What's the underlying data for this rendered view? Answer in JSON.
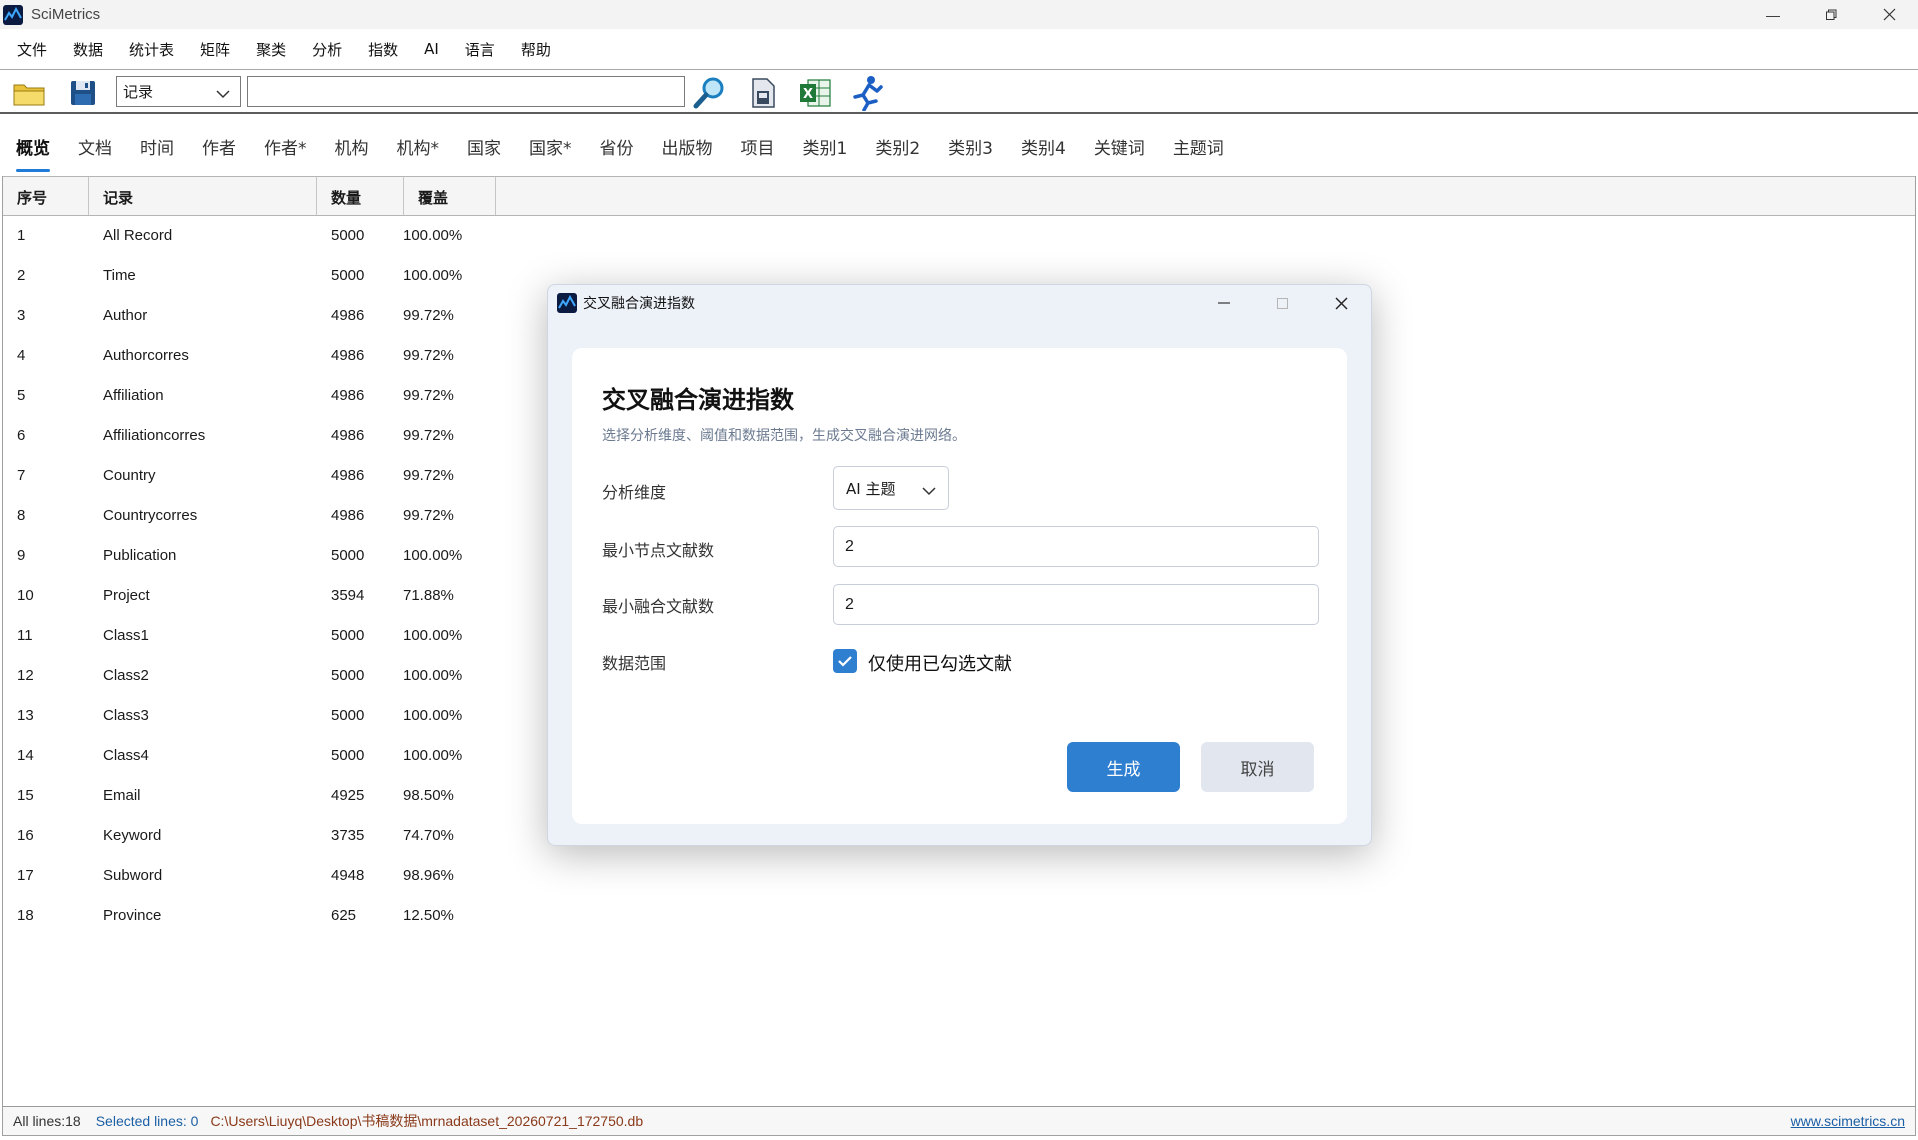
{
  "window": {
    "title": "SciMetrics"
  },
  "menu": [
    "文件",
    "数据",
    "统计表",
    "矩阵",
    "聚类",
    "分析",
    "指数",
    "AI",
    "语言",
    "帮助"
  ],
  "toolbar": {
    "icons": [
      "open-folder-icon",
      "save-disk-icon",
      "search-magnifier-icon",
      "document-export-icon",
      "excel-icon",
      "run-person-icon"
    ],
    "combo_value": "记录",
    "search_value": ""
  },
  "tabs": [
    "概览",
    "文档",
    "时间",
    "作者",
    "作者*",
    "机构",
    "机构*",
    "国家",
    "国家*",
    "省份",
    "出版物",
    "项目",
    "类别1",
    "类别2",
    "类别3",
    "类别4",
    "关键词",
    "主题词"
  ],
  "active_tab": "概览",
  "table": {
    "headers": [
      "序号",
      "记录",
      "数量",
      "覆盖"
    ],
    "rows": [
      [
        "1",
        "All Record",
        "5000",
        "100.00%"
      ],
      [
        "2",
        "Time",
        "5000",
        "100.00%"
      ],
      [
        "3",
        "Author",
        "4986",
        "99.72%"
      ],
      [
        "4",
        "Authorcorres",
        "4986",
        "99.72%"
      ],
      [
        "5",
        "Affiliation",
        "4986",
        "99.72%"
      ],
      [
        "6",
        "Affiliationcorres",
        "4986",
        "99.72%"
      ],
      [
        "7",
        "Country",
        "4986",
        "99.72%"
      ],
      [
        "8",
        "Countrycorres",
        "4986",
        "99.72%"
      ],
      [
        "9",
        "Publication",
        "5000",
        "100.00%"
      ],
      [
        "10",
        "Project",
        "3594",
        "71.88%"
      ],
      [
        "11",
        "Class1",
        "5000",
        "100.00%"
      ],
      [
        "12",
        "Class2",
        "5000",
        "100.00%"
      ],
      [
        "13",
        "Class3",
        "5000",
        "100.00%"
      ],
      [
        "14",
        "Class4",
        "5000",
        "100.00%"
      ],
      [
        "15",
        "Email",
        "4925",
        "98.50%"
      ],
      [
        "16",
        "Keyword",
        "3735",
        "74.70%"
      ],
      [
        "17",
        "Subword",
        "4948",
        "98.96%"
      ],
      [
        "18",
        "Province",
        "625",
        "12.50%"
      ]
    ]
  },
  "status": {
    "all_lines": "All lines:18",
    "selected_lines": "Selected lines: 0",
    "path": "C:\\Users\\Liuyq\\Desktop\\书稿数据\\mrnadataset_20260721_172750.db",
    "link": "www.scimetrics.cn"
  },
  "dialog": {
    "window_title": "交叉融合演进指数",
    "heading": "交叉融合演进指数",
    "subtitle": "选择分析维度、阈值和数据范围，生成交叉融合演进网络。",
    "dimension_label": "分析维度",
    "dimension_value": "AI 主题",
    "min_node_label": "最小节点文献数",
    "min_node_value": "2",
    "min_fusion_label": "最小融合文献数",
    "min_fusion_value": "2",
    "scope_label": "数据范围",
    "checkbox_label": "仅使用已勾选文献",
    "checkbox_checked": true,
    "generate_button": "生成",
    "cancel_button": "取消"
  },
  "colors": {
    "accent": "#2f7fd1",
    "tab_underline": "#1f7ad8",
    "status_link": "#1b5fa5",
    "status_path": "#8a3a1a"
  }
}
